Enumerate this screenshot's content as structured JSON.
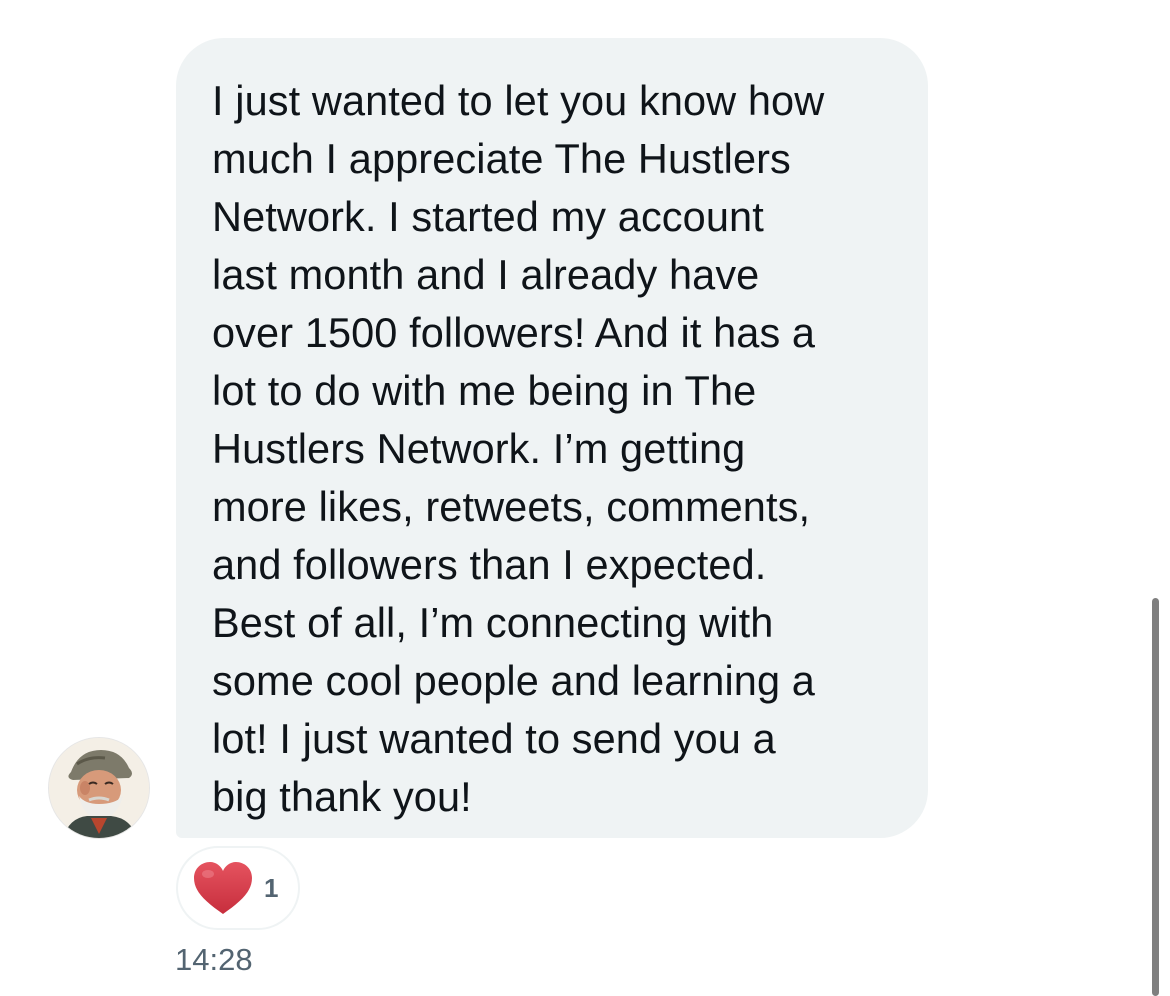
{
  "message": {
    "text": "I just wanted to let you know how\nmuch I appreciate The Hustlers\nNetwork. I started my account\nlast month and I already have\nover 1500 followers! And it has a\nlot to do with me being in The\nHustlers Network. I’m getting\nmore likes, retweets, comments,\nand followers than I expected.\nBest of all, I’m connecting with\nsome cool people and learning a\nlot! I just wanted to send you a\nbig thank you!",
    "reaction": {
      "icon": "heart-icon",
      "count": "1",
      "color": "#d83a4a"
    },
    "timestamp": "14:28"
  },
  "sender": {
    "avatar_icon": "avatar"
  },
  "colors": {
    "bubble_background": "#eff3f4",
    "text": "#0f1419",
    "secondary_text": "#536471"
  }
}
